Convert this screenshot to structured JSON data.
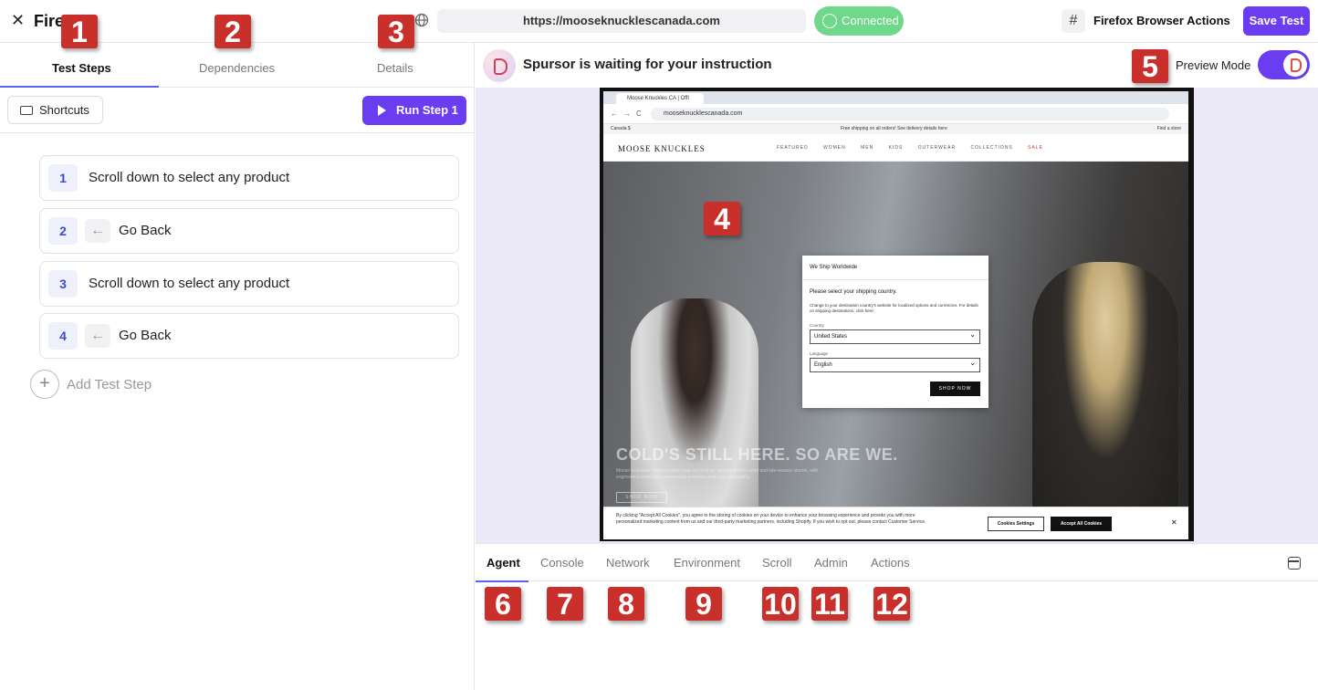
{
  "header": {
    "close_symbol": "✕",
    "app_title": "Fire",
    "url": "https://mooseknucklescanada.com",
    "connected_label": "Connected",
    "hash_symbol": "#",
    "actions_label": "Firefox Browser Actions",
    "save_label": "Save Test"
  },
  "badges": [
    "1",
    "2",
    "3",
    "4",
    "5",
    "6",
    "7",
    "8",
    "9",
    "10",
    "11",
    "12"
  ],
  "left_tabs": [
    "Test Steps",
    "Dependencies",
    "Details"
  ],
  "toolbar": {
    "shortcuts_label": "Shortcuts",
    "run_label": "Run Step 1"
  },
  "steps": [
    {
      "num": "1",
      "text": "Scroll down to select any product",
      "icon": ""
    },
    {
      "num": "2",
      "text": "Go Back",
      "icon": "back-arrow-icon"
    },
    {
      "num": "3",
      "text": "Scroll down to select any product",
      "icon": ""
    },
    {
      "num": "4",
      "text": "Go Back",
      "icon": "back-arrow-icon"
    }
  ],
  "back_arrow": "←",
  "add_step": {
    "symbol": "+",
    "label": "Add Test Step"
  },
  "agent": {
    "status_text": "Spursor is waiting for your instruction",
    "preview_label": "Preview Mode"
  },
  "browser": {
    "tab_title": "Moose Knuckles CA | Offi",
    "address": "mooseknucklescanada.com",
    "nav_buttons": "←→C",
    "promo_left": "Canada $",
    "promo_center": "Free shipping on all orders! See delivery details here",
    "promo_right": "Find a store",
    "logo": "MOOSE KNUCKLES",
    "menu": [
      "FEATURED",
      "WOMEN",
      "MEN",
      "KIDS",
      "OUTERWEAR",
      "COLLECTIONS",
      "SALE"
    ],
    "hero_headline": "COLD'S STILL HERE. SO ARE WE.",
    "hero_sub": "Moose Knuckles' featherweight coats are built for fighting winter's wind and late-season storms, with engineered protection, unexpected presence and total adaptability.",
    "hero_button": "SHOP NOW",
    "modal": {
      "title": "We Ship Worldwide",
      "question": "Please select your shipping country.",
      "description": "Change to your destination country's website for localized options and currencies. For details on shipping destinations, click here.",
      "country_label": "Country",
      "country_value": "United States",
      "language_label": "Language",
      "language_value": "English",
      "shop_button": "SHOP NOW"
    },
    "cookie": {
      "text": "By clicking \"Accept All Cookies\", you agree to the storing of cookies on your device to enhance your browsing experience and provide you with more personalized marketing content from us and our third-party marketing partners, including Shopify. If you wish to opt out, please contact Customer Service.",
      "settings_label": "Cookies Settings",
      "accept_label": "Accept All Cookies",
      "close_symbol": "✕"
    }
  },
  "bottom_tabs": [
    "Agent",
    "Console",
    "Network",
    "Environment",
    "Scroll",
    "Admin",
    "Actions"
  ],
  "colors": {
    "accent": "#6b3df0",
    "connected": "#6fd88a",
    "badge": "#c9302c",
    "tab_underline": "#5865f2"
  }
}
